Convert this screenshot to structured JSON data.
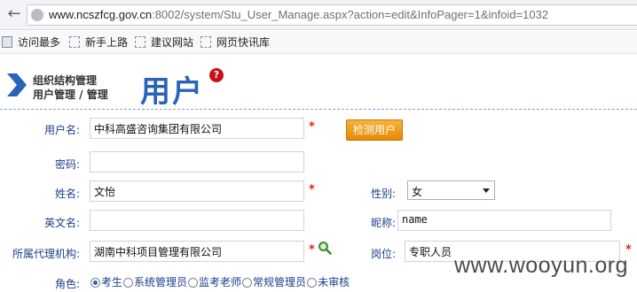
{
  "browser": {
    "url_host": "www.ncszfcg.gov.cn",
    "url_path": ":8002/system/Stu_User_Manage.aspx?action=edit&InfoPager=1&infoid=1032",
    "bookmarks": [
      "访问最多",
      "新手上路",
      "建议网站",
      "网页快讯库"
    ]
  },
  "header": {
    "section": "组织结构管理",
    "subsection": "用户管理 / 管理",
    "big_title": "用户",
    "help_glyph": "?"
  },
  "form": {
    "username_label": "用户名:",
    "username_value": "中科高盛咨询集团有限公司",
    "check_button": "检测用户",
    "password_label": "密码:",
    "password_value": "",
    "name_label": "姓名:",
    "name_value": "文怡",
    "gender_label": "性别:",
    "gender_value": "女",
    "english_name_label": "英文名:",
    "english_name_value": "",
    "nickname_label": "昵称:",
    "nickname_value": "name",
    "agency_label": "所属代理机构:",
    "agency_value": "湖南中科项目管理有限公司",
    "position_label": "岗位:",
    "position_value": "专职人员",
    "required_mark": "*",
    "role_label": "角色:",
    "roles": [
      "考生",
      "系统管理员",
      "监考老师",
      "常规管理员",
      "未审核"
    ],
    "selected_role": "考生"
  },
  "watermark": "www.wooyun.org",
  "colors": {
    "label": "#1b3f8b",
    "title_blue": "#2a63b8",
    "button_orange": "#f0a020",
    "required_red": "#e02020"
  }
}
